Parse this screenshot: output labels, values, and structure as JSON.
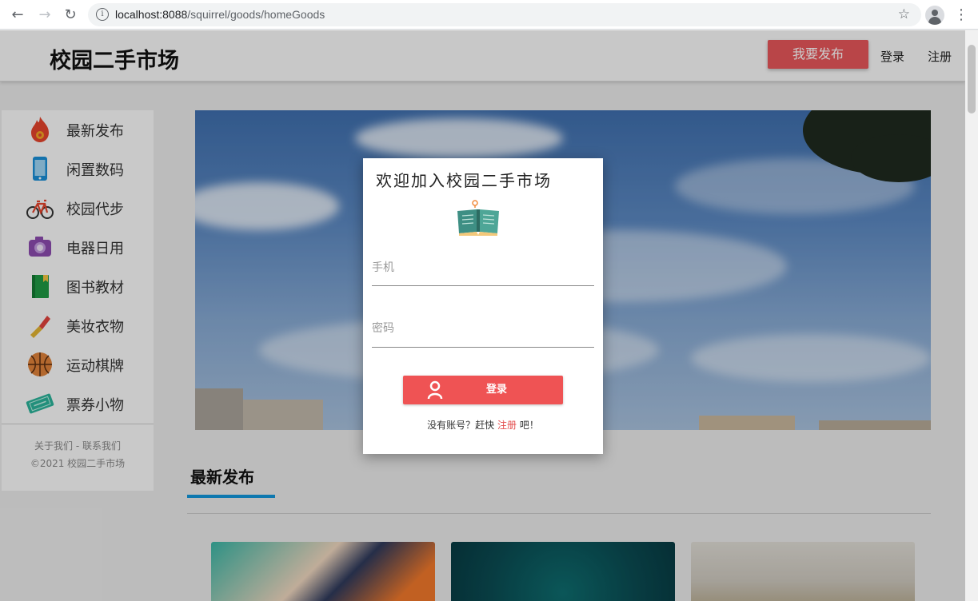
{
  "browser": {
    "url_host": "localhost:8088",
    "url_path": "/squirrel/goods/homeGoods"
  },
  "header": {
    "site_title": "校园二手市场",
    "publish_button": "我要发布",
    "login": "登录",
    "register": "注册"
  },
  "sidebar": {
    "items": [
      {
        "label": "最新发布",
        "icon": "fire-icon"
      },
      {
        "label": "闲置数码",
        "icon": "phone-icon"
      },
      {
        "label": "校园代步",
        "icon": "bicycle-icon"
      },
      {
        "label": "电器日用",
        "icon": "camera-icon"
      },
      {
        "label": "图书教材",
        "icon": "book-icon"
      },
      {
        "label": "美妆衣物",
        "icon": "lipstick-icon"
      },
      {
        "label": "运动棋牌",
        "icon": "basketball-icon"
      },
      {
        "label": "票券小物",
        "icon": "ticket-icon"
      }
    ],
    "footer_links": "关于我们 - 联系我们",
    "copyright": "©2021 校园二手市场"
  },
  "section": {
    "title": "最新发布"
  },
  "modal": {
    "title": "欢迎加入校园二手市场",
    "phone_placeholder": "手机",
    "password_placeholder": "密码",
    "login_button": "登录",
    "signup_prefix": "没有账号？赶快",
    "signup_link": "注册",
    "signup_suffix": "吧！"
  },
  "colors": {
    "accent_red": "#e8575a",
    "section_underline": "#1296db"
  }
}
